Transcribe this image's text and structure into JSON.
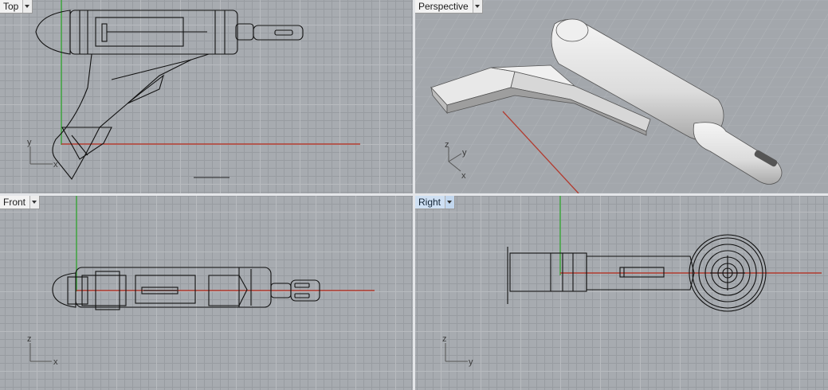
{
  "viewports": {
    "top": {
      "label": "Top",
      "active": false
    },
    "perspective": {
      "label": "Perspective",
      "active": false
    },
    "front": {
      "label": "Front",
      "active": false
    },
    "right": {
      "label": "Right",
      "active": true
    }
  },
  "axes": {
    "top": {
      "vertical": "y",
      "horizontal": "x"
    },
    "perspective": {
      "z": "z",
      "y": "y",
      "x": "x"
    },
    "front": {
      "vertical": "z",
      "horizontal": "x"
    },
    "right": {
      "vertical": "z",
      "horizontal": "y"
    }
  },
  "colors": {
    "x_axis": "#b23a2e",
    "y_axis": "#3aa23a",
    "active_tab": "#cfe0f3",
    "divider": "#e4e6e9"
  }
}
